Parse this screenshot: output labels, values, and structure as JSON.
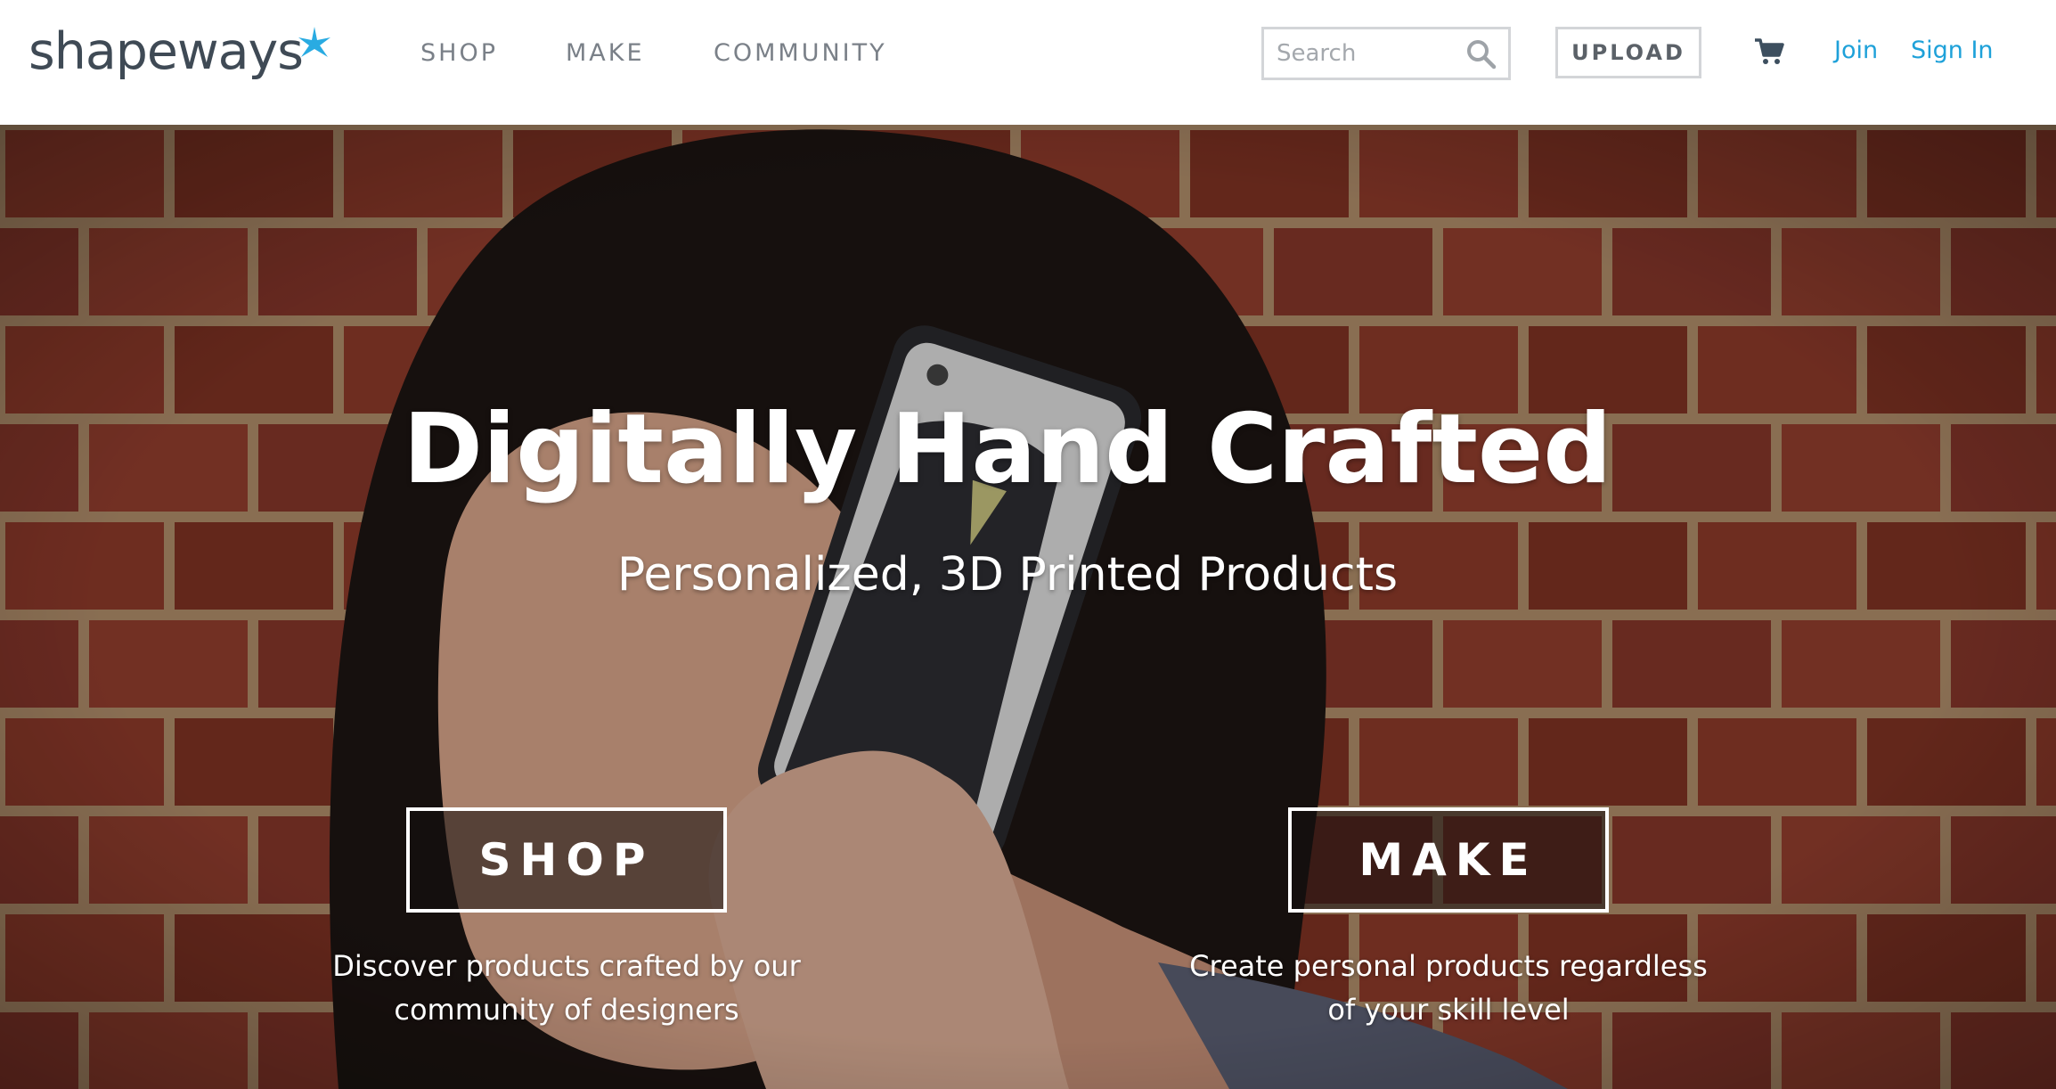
{
  "header": {
    "logo_text": "shapeways",
    "logo_star_color": "#29abe2",
    "nav": {
      "shop": "SHOP",
      "make": "MAKE",
      "community": "COMMUNITY"
    },
    "search": {
      "placeholder": "Search",
      "icon": "search-icon"
    },
    "upload_label": "UPLOAD",
    "cart_icon": "cart-icon",
    "join_label": "Join",
    "signin_label": "Sign In",
    "link_color": "#1ea1d9"
  },
  "hero": {
    "title": "Digitally Hand Crafted",
    "subtitle": "Personalized, 3D Printed Products",
    "shop": {
      "label": "SHOP",
      "desc_line1": "Discover products crafted by our",
      "desc_line2": "community of designers"
    },
    "make": {
      "label": "MAKE",
      "desc_line1": "Create personal products regardless",
      "desc_line2": "of your skill level"
    }
  }
}
